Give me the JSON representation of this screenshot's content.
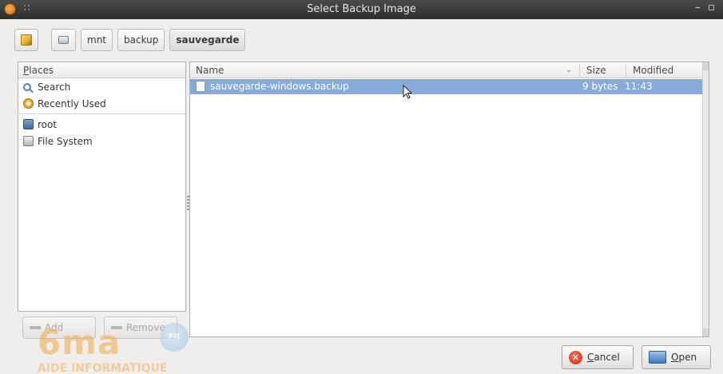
{
  "window": {
    "title": "Select Backup Image",
    "menu_glyph": "∷",
    "minimize_glyph": "–",
    "maximize_glyph": "▫",
    "app_icon": "app-swirl-icon"
  },
  "pathbar": {
    "edit_icon": "pencil-icon",
    "crumbs": [
      "mnt",
      "backup",
      "sauvegarde"
    ],
    "active_crumb": "sauvegarde"
  },
  "places": {
    "header_prefix": "P",
    "header_rest": "laces",
    "items": [
      {
        "label": "Search",
        "icon": "search-icon"
      },
      {
        "label": "Recently Used",
        "icon": "recent-icon"
      },
      {
        "label": "root",
        "icon": "home-folder-icon"
      },
      {
        "label": "File System",
        "icon": "drive-icon"
      }
    ],
    "add_label": "Add",
    "remove_label": "Remove"
  },
  "file_list": {
    "columns": {
      "name": "Name",
      "size": "Size",
      "modified": "Modified"
    },
    "rows": [
      {
        "name": "sauvegarde-windows.backup",
        "size": "9 bytes",
        "modified": "11:43",
        "selected": true
      }
    ]
  },
  "buttons": {
    "cancel_underlined": "C",
    "cancel_rest": "ancel",
    "open_underlined": "O",
    "open_rest": "pen"
  },
  "watermark": {
    "logo": "6ma",
    "badge": "FR",
    "tagline": "AIDE INFORMATIQUE"
  },
  "colors": {
    "selection": "#86abd9",
    "titlebar": "#3a3a38",
    "background": "#efeeec"
  }
}
